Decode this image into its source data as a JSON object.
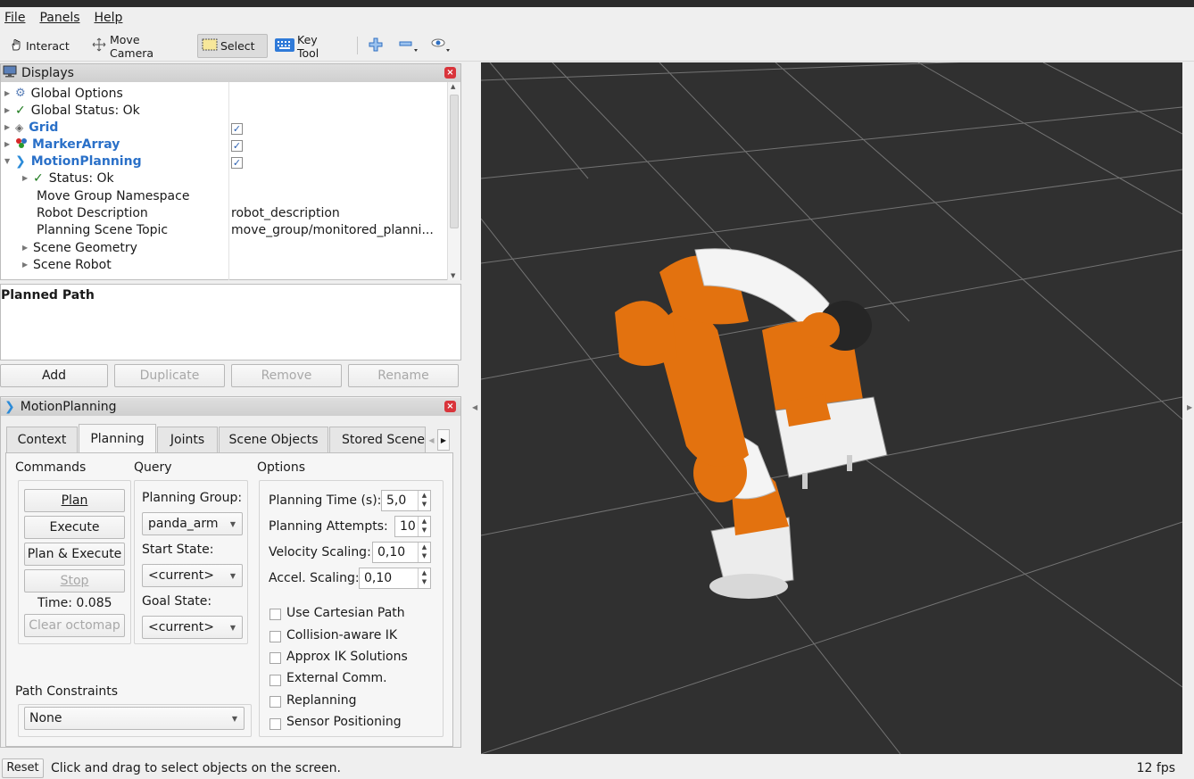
{
  "menu": {
    "file": "File",
    "panels": "Panels",
    "help": "Help"
  },
  "toolbar": {
    "interact": "Interact",
    "move_camera": "Move Camera",
    "select": "Select",
    "key_tool": "Key Tool"
  },
  "displays": {
    "title": "Displays",
    "items": [
      {
        "label": "Global Options",
        "value": ""
      },
      {
        "label": "Global Status: Ok",
        "value": ""
      },
      {
        "label": "Grid",
        "value": "",
        "checked": true
      },
      {
        "label": "MarkerArray",
        "value": "",
        "checked": true
      },
      {
        "label": "MotionPlanning",
        "value": "",
        "checked": true
      },
      {
        "label": "Status: Ok",
        "value": ""
      },
      {
        "label": "Move Group Namespace",
        "value": ""
      },
      {
        "label": "Robot Description",
        "value": "robot_description"
      },
      {
        "label": "Planning Scene Topic",
        "value": "move_group/monitored_planni..."
      },
      {
        "label": "Scene Geometry",
        "value": ""
      },
      {
        "label": "Scene Robot",
        "value": ""
      }
    ]
  },
  "planned_path": {
    "title": "Planned Path"
  },
  "path_buttons": {
    "add": "Add",
    "duplicate": "Duplicate",
    "remove": "Remove",
    "rename": "Rename"
  },
  "motion_planning": {
    "title": "MotionPlanning",
    "tabs": [
      "Context",
      "Planning",
      "Joints",
      "Scene Objects",
      "Stored Scene"
    ],
    "active_tab": "Planning",
    "commands": {
      "heading": "Commands",
      "plan": "Plan",
      "execute": "Execute",
      "plan_execute": "Plan & Execute",
      "stop": "Stop",
      "time": "Time: 0.085",
      "clear_octomap": "Clear octomap"
    },
    "query": {
      "heading": "Query",
      "planning_group_label": "Planning Group:",
      "planning_group": "panda_arm",
      "start_state_label": "Start State:",
      "start_state": "<current>",
      "goal_state_label": "Goal State:",
      "goal_state": "<current>"
    },
    "options": {
      "heading": "Options",
      "planning_time_label": "Planning Time (s):",
      "planning_time": "5,0",
      "planning_attempts_label": "Planning Attempts:",
      "planning_attempts": "10",
      "velocity_label": "Velocity Scaling:",
      "velocity": "0,10",
      "accel_label": "Accel. Scaling:",
      "accel": "0,10",
      "checkboxes": [
        "Use Cartesian Path",
        "Collision-aware IK",
        "Approx IK Solutions",
        "External Comm.",
        "Replanning",
        "Sensor Positioning"
      ]
    },
    "path_constraints": {
      "label": "Path Constraints",
      "value": "None"
    }
  },
  "status": {
    "reset": "Reset",
    "message": "Click and drag to select objects on the screen.",
    "fps": "12 fps"
  },
  "icons": [
    "hand-icon",
    "camera-icon",
    "select-icon",
    "keyboard-icon",
    "plus-icon",
    "minus-icon",
    "eye-icon",
    "close-icon",
    "gear-icon",
    "check-icon",
    "grid-icon",
    "marker-icon",
    "motion-icon"
  ],
  "colors": {
    "accent_blue": "#2a70c8",
    "robot_orange": "#e3720f",
    "viewport_bg": "#303030",
    "close_red": "#d9343b"
  }
}
